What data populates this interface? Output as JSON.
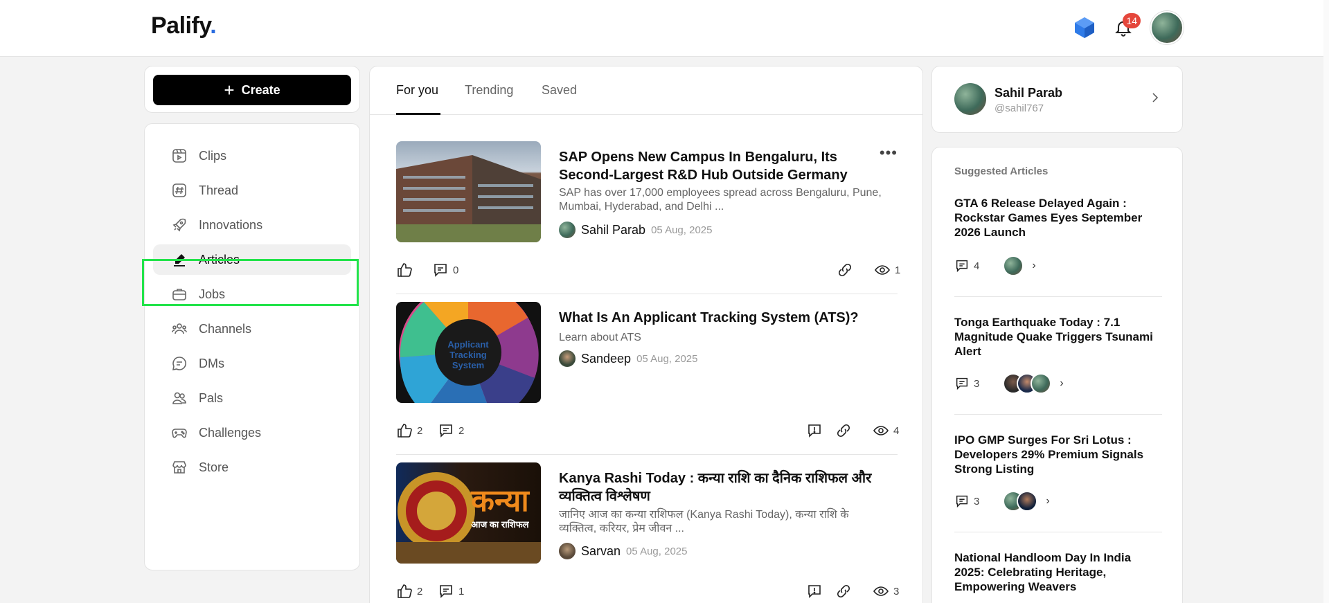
{
  "app": {
    "logo": "Palify",
    "logo_dot": "."
  },
  "header": {
    "notification_count": "14"
  },
  "create": {
    "label": "Create"
  },
  "nav": {
    "items": [
      {
        "label": "Clips",
        "icon": "clips-icon"
      },
      {
        "label": "Thread",
        "icon": "hash-icon"
      },
      {
        "label": "Innovations",
        "icon": "rocket-icon"
      },
      {
        "label": "Articles",
        "icon": "pen-icon",
        "active": true
      },
      {
        "label": "Jobs",
        "icon": "briefcase-icon"
      },
      {
        "label": "Channels",
        "icon": "channels-icon"
      },
      {
        "label": "DMs",
        "icon": "chat-icon"
      },
      {
        "label": "Pals",
        "icon": "users-icon"
      },
      {
        "label": "Challenges",
        "icon": "gamepad-icon"
      },
      {
        "label": "Store",
        "icon": "store-icon"
      }
    ]
  },
  "feed": {
    "tabs": [
      {
        "label": "For you",
        "active": true
      },
      {
        "label": "Trending"
      },
      {
        "label": "Saved"
      }
    ],
    "posts": [
      {
        "title": "SAP Opens New Campus In Bengaluru, Its Second-Largest R&D Hub Outside Germany",
        "desc": "SAP has over 17,000 employees spread across Bengaluru, Pune, Mumbai, Hyderabad, and Delhi ...",
        "author": "Sahil Parab",
        "date": "05 Aug, 2025",
        "likes": "",
        "comments": "0",
        "views": "1"
      },
      {
        "title": "What Is An Applicant Tracking System (ATS)?",
        "desc": "Learn about ATS",
        "author": "Sandeep",
        "date": "05 Aug, 2025",
        "likes": "2",
        "comments": "2",
        "views": "4",
        "thumb_text": "Applicant Tracking System"
      },
      {
        "title": "Kanya Rashi Today : कन्या राशि का दैनिक राशिफल और व्यक्तित्व विश्लेषण",
        "desc": "जानिए आज का कन्या राशिफल (Kanya Rashi Today), कन्या राशि के व्यक्तित्व, करियर, प्रेम जीवन ...",
        "author": "Sarvan",
        "date": "05 Aug, 2025",
        "likes": "2",
        "comments": "1",
        "views": "3",
        "thumb_text": "कन्या",
        "thumb_sub": "आज का राशिफल"
      }
    ]
  },
  "profile": {
    "name": "Sahil Parab",
    "handle": "@sahil767"
  },
  "suggested": {
    "heading": "Suggested Articles",
    "items": [
      {
        "title": "GTA 6 Release Delayed Again : Rockstar Games Eyes September 2026 Launch",
        "comments": "4"
      },
      {
        "title": "Tonga Earthquake Today : 7.1 Magnitude Quake Triggers Tsunami Alert",
        "comments": "3"
      },
      {
        "title": "IPO GMP Surges For Sri Lotus : Developers 29% Premium Signals Strong Listing",
        "comments": "3"
      },
      {
        "title": "National Handloom Day In India 2025: Celebrating Heritage, Empowering Weavers",
        "comments": ""
      }
    ]
  }
}
